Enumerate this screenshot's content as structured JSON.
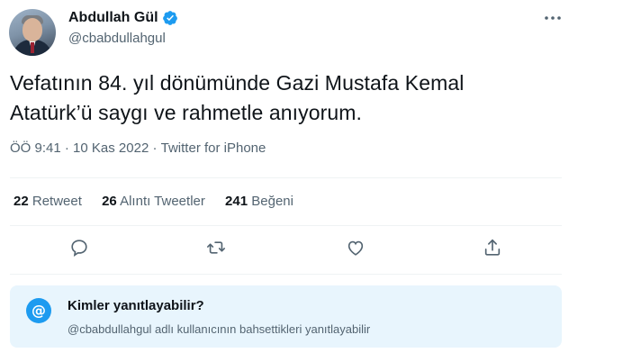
{
  "author": {
    "name": "Abdullah Gül",
    "handle": "@cbabdullahgul"
  },
  "tweet": {
    "text_line1": "Vefatının 84. yıl dönümünde Gazi Mustafa Kemal",
    "text_line2": "Atatürk’ü saygı ve rahmetle anıyorum."
  },
  "meta": {
    "time": "ÖÖ 9:41",
    "separator": "·",
    "date": "10 Kas 2022",
    "source": "Twitter for iPhone"
  },
  "stats": [
    {
      "count": "22",
      "label": "Retweet"
    },
    {
      "count": "26",
      "label": "Alıntı Tweetler"
    },
    {
      "count": "241",
      "label": "Beğeni"
    }
  ],
  "reply_restriction": {
    "title": "Kimler yanıtlayabilir?",
    "description": "@cbabdullahgul adlı kullanıcının bahsettikleri yanıtlayabilir",
    "icon_glyph": "@"
  },
  "colors": {
    "accent": "#1d9bf0",
    "secondary_text": "#536471",
    "primary_text": "#0f1419",
    "reply_box_bg": "#e8f5fd"
  }
}
